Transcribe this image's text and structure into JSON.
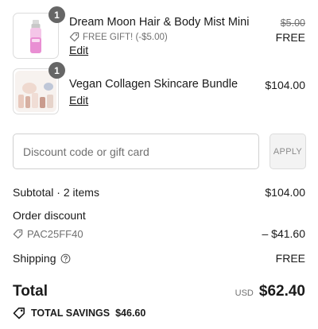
{
  "items": [
    {
      "quantity": "1",
      "name": "Dream Moon Hair & Body Mist Mini",
      "gift_note": "FREE GIFT! (-$5.00)",
      "edit_label": "Edit",
      "original_price": "$5.00",
      "price": "FREE"
    },
    {
      "quantity": "1",
      "name": "Vegan Collagen Skincare Bundle",
      "edit_label": "Edit",
      "price": "$104.00"
    }
  ],
  "discount": {
    "placeholder": "Discount code or gift card",
    "apply_label": "APPLY"
  },
  "summary": {
    "subtotal_label": "Subtotal · 2 items",
    "subtotal_value": "$104.00",
    "order_discount_label": "Order discount",
    "discount_code": "PAC25FF40",
    "discount_value": "– $41.60",
    "shipping_label": "Shipping",
    "shipping_value": "FREE",
    "total_label": "Total",
    "currency": "USD",
    "total_value": "$62.40",
    "savings_label": "TOTAL SAVINGS",
    "savings_value": "$46.60"
  },
  "icons": {
    "tag": "tag-icon",
    "help": "help-circle-icon",
    "savings": "savings-tag-icon"
  },
  "colors": {
    "muted_text": "#707070",
    "badge": "#666666",
    "apply_bg": "#f3f3f3"
  }
}
